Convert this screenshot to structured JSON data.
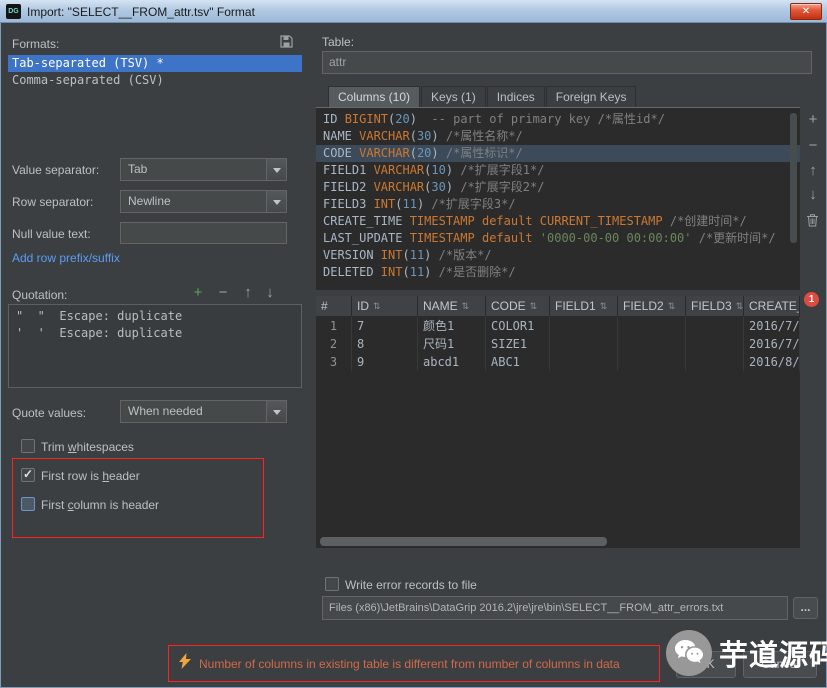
{
  "titlebar": {
    "icon_text": "DG",
    "title": "Import: \"SELECT__FROM_attr.tsv\" Format",
    "close_glyph": "✕"
  },
  "icons": {
    "plus": "+",
    "minus": "−",
    "arrow_up": "↑",
    "arrow_down": "↓",
    "sort": "⇅"
  },
  "left": {
    "formats_label": "Formats:",
    "formats": [
      {
        "label": "Tab-separated (TSV) *",
        "selected": true
      },
      {
        "label": "Comma-separated (CSV)",
        "selected": false
      }
    ],
    "value_separator_label": "Value separator:",
    "value_separator_value": "Tab",
    "row_separator_label": "Row separator:",
    "row_separator_value": "Newline",
    "null_value_label": "Null value text:",
    "null_value_value": "",
    "add_prefix_link": "Add row prefix/suffix",
    "quotation_label": "Quotation:",
    "quotation_items": [
      "\"  \"  Escape: duplicate",
      "'  '  Escape: duplicate"
    ],
    "quote_values_label": "Quote values:",
    "quote_values_value": "When needed",
    "trim_label": "Trim &whitespaces",
    "trim_checked": false,
    "first_row_label": "First row is &header",
    "first_row_checked": true,
    "first_col_label": "First &column is header",
    "first_col_checked": false
  },
  "right": {
    "table_label": "Table:",
    "table_name": "attr",
    "tabs": [
      {
        "label": "Columns (10)",
        "selected": true
      },
      {
        "label": "Keys (1)",
        "selected": false
      },
      {
        "label": "Indices",
        "selected": false
      },
      {
        "label": "Foreign Keys",
        "selected": false
      }
    ],
    "ddl_lines": [
      {
        "hl": false,
        "tokens": [
          [
            "ID ",
            "n"
          ],
          [
            "BIGINT",
            "k"
          ],
          [
            "(",
            "p"
          ],
          [
            "20",
            "d"
          ],
          [
            ")",
            "p"
          ],
          [
            "  ",
            "p"
          ],
          [
            "-- part of primary key ",
            "c"
          ],
          [
            "/*属性id*/",
            "c"
          ]
        ]
      },
      {
        "hl": false,
        "tokens": [
          [
            "NAME ",
            "n"
          ],
          [
            "VARCHAR",
            "k"
          ],
          [
            "(",
            "p"
          ],
          [
            "30",
            "d"
          ],
          [
            ")",
            "p"
          ],
          [
            " ",
            "p"
          ],
          [
            "/*属性名称*/",
            "c"
          ]
        ]
      },
      {
        "hl": true,
        "tokens": [
          [
            "CODE ",
            "n"
          ],
          [
            "VARCHAR",
            "k"
          ],
          [
            "(",
            "p"
          ],
          [
            "20",
            "d"
          ],
          [
            ")",
            "p"
          ],
          [
            " ",
            "p"
          ],
          [
            "/*属性标识*/",
            "c"
          ]
        ]
      },
      {
        "hl": false,
        "tokens": [
          [
            "FIELD1 ",
            "n"
          ],
          [
            "VARCHAR",
            "k"
          ],
          [
            "(",
            "p"
          ],
          [
            "10",
            "d"
          ],
          [
            ")",
            "p"
          ],
          [
            " ",
            "p"
          ],
          [
            "/*扩展字段1*/",
            "c"
          ]
        ]
      },
      {
        "hl": false,
        "tokens": [
          [
            "FIELD2 ",
            "n"
          ],
          [
            "VARCHAR",
            "k"
          ],
          [
            "(",
            "p"
          ],
          [
            "30",
            "d"
          ],
          [
            ")",
            "p"
          ],
          [
            " ",
            "p"
          ],
          [
            "/*扩展字段2*/",
            "c"
          ]
        ]
      },
      {
        "hl": false,
        "tokens": [
          [
            "FIELD3 ",
            "n"
          ],
          [
            "INT",
            "k"
          ],
          [
            "(",
            "p"
          ],
          [
            "11",
            "d"
          ],
          [
            ")",
            "p"
          ],
          [
            " ",
            "p"
          ],
          [
            "/*扩展字段3*/",
            "c"
          ]
        ]
      },
      {
        "hl": false,
        "tokens": [
          [
            "CREATE_TIME ",
            "n"
          ],
          [
            "TIMESTAMP",
            "k"
          ],
          [
            " ",
            "p"
          ],
          [
            "default",
            "k"
          ],
          [
            " ",
            "p"
          ],
          [
            "CURRENT_TIMESTAMP",
            "k"
          ],
          [
            " ",
            "p"
          ],
          [
            "/*创建时间*/",
            "c"
          ]
        ]
      },
      {
        "hl": false,
        "tokens": [
          [
            "LAST_UPDATE ",
            "n"
          ],
          [
            "TIMESTAMP",
            "k"
          ],
          [
            " ",
            "p"
          ],
          [
            "default",
            "k"
          ],
          [
            " ",
            "p"
          ],
          [
            "'0000-00-00 00:00:00'",
            "s"
          ],
          [
            " ",
            "p"
          ],
          [
            "/*更新时间*/",
            "c"
          ]
        ]
      },
      {
        "hl": false,
        "tokens": [
          [
            "VERSION ",
            "n"
          ],
          [
            "INT",
            "k"
          ],
          [
            "(",
            "p"
          ],
          [
            "11",
            "d"
          ],
          [
            ")",
            "p"
          ],
          [
            " ",
            "p"
          ],
          [
            "/*版本*/",
            "c"
          ]
        ]
      },
      {
        "hl": false,
        "tokens": [
          [
            "DELETED ",
            "n"
          ],
          [
            "INT",
            "k"
          ],
          [
            "(",
            "p"
          ],
          [
            "11",
            "d"
          ],
          [
            ")",
            "p"
          ],
          [
            " ",
            "p"
          ],
          [
            "/*是否删除*/",
            "c"
          ]
        ]
      }
    ],
    "error_badge": "1",
    "grid": {
      "headers": [
        "#",
        "ID",
        "NAME",
        "CODE",
        "FIELD1",
        "FIELD2",
        "FIELD3",
        "CREATE_"
      ],
      "rows": [
        [
          "1",
          "7",
          "颜色1",
          "COLOR1",
          "",
          "",
          "",
          "2016/7/"
        ],
        [
          "2",
          "8",
          "尺码1",
          "SIZE1",
          "",
          "",
          "",
          "2016/7/"
        ],
        [
          "3",
          "9",
          "abcd1",
          "ABC1",
          "",
          "",
          "",
          "2016/8/"
        ]
      ]
    },
    "write_errors_label": "Write error records to file",
    "write_errors_checked": false,
    "error_path": "Files (x86)\\JetBrains\\DataGrip 2016.2\\jre\\jre\\bin\\SELECT__FROM_attr_errors.txt",
    "browse_label": "..."
  },
  "footer": {
    "warning": "Number of columns in existing table is different from number of columns in data",
    "ok_label": "OK",
    "cancel_label": "Cancel",
    "watermark_text": "芋道源码"
  }
}
